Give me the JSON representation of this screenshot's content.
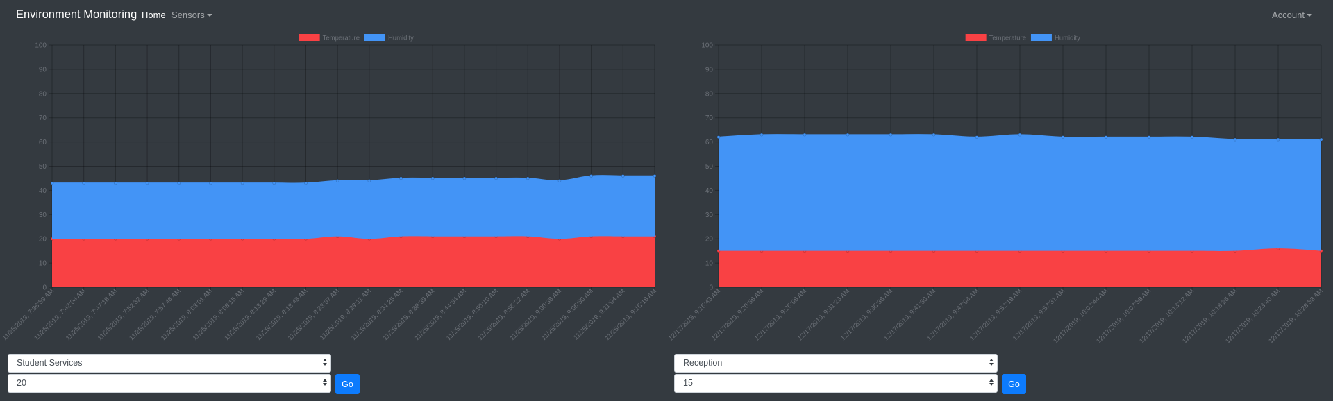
{
  "nav": {
    "brand": "Environment Monitoring",
    "home": "Home",
    "sensors": "Sensors",
    "account": "Account"
  },
  "colors": {
    "background": "#343a40",
    "temperature": "#f94144",
    "humidity": "#4394f6",
    "go_button": "#0d7bfd"
  },
  "chart_data": [
    {
      "type": "area",
      "stacked": true,
      "legend_position": "top",
      "grid": true,
      "ylim": [
        0,
        100
      ],
      "y_ticks": [
        0,
        10,
        20,
        30,
        40,
        50,
        60,
        70,
        80,
        90,
        100
      ],
      "x": [
        "11/25/2019, 7:36:59 AM",
        "11/25/2019, 7:42:04 AM",
        "11/25/2019, 7:47:18 AM",
        "11/25/2019, 7:52:32 AM",
        "11/25/2019, 7:57:46 AM",
        "11/25/2019, 8:03:01 AM",
        "11/25/2019, 8:08:15 AM",
        "11/25/2019, 8:13:29 AM",
        "11/25/2019, 8:18:43 AM",
        "11/25/2019, 8:23:57 AM",
        "11/25/2019, 8:29:11 AM",
        "11/25/2019, 8:34:25 AM",
        "11/25/2019, 8:39:39 AM",
        "11/25/2019, 8:44:54 AM",
        "11/25/2019, 8:50:10 AM",
        "11/25/2019, 8:55:22 AM",
        "11/25/2019, 9:00:36 AM",
        "11/25/2019, 9:05:50 AM",
        "11/25/2019, 9:11:04 AM",
        "11/25/2019, 9:16:18 AM"
      ],
      "series": [
        {
          "name": "Temperature",
          "values": [
            20,
            20,
            20,
            20,
            20,
            20,
            20,
            20,
            20,
            21,
            20,
            21,
            21,
            21,
            21,
            21,
            20,
            21,
            21,
            21
          ]
        },
        {
          "name": "Humidity",
          "values": [
            23,
            23,
            23,
            23,
            23,
            23,
            23,
            23,
            23,
            23,
            24,
            24,
            24,
            24,
            24,
            24,
            24,
            25,
            25,
            25
          ]
        }
      ]
    },
    {
      "type": "area",
      "stacked": true,
      "legend_position": "top",
      "grid": true,
      "ylim": [
        0,
        100
      ],
      "y_ticks": [
        0,
        10,
        20,
        30,
        40,
        50,
        60,
        70,
        80,
        90,
        100
      ],
      "x": [
        "12/17/2019, 9:15:43 AM",
        "12/17/2019, 9:20:58 AM",
        "12/17/2019, 9:26:08 AM",
        "12/17/2019, 9:31:23 AM",
        "12/17/2019, 9:36:36 AM",
        "12/17/2019, 9:41:50 AM",
        "12/17/2019, 9:47:04 AM",
        "12/17/2019, 9:52:18 AM",
        "12/17/2019, 9:57:31 AM",
        "12/17/2019, 10:02:44 AM",
        "12/17/2019, 10:07:58 AM",
        "12/17/2019, 10:13:12 AM",
        "12/17/2019, 10:18:26 AM",
        "12/17/2019, 10:23:40 AM",
        "12/17/2019, 10:28:53 AM"
      ],
      "series": [
        {
          "name": "Temperature",
          "values": [
            15,
            15,
            15,
            15,
            15,
            15,
            15,
            15,
            15,
            15,
            15,
            15,
            15,
            16,
            15
          ]
        },
        {
          "name": "Humidity",
          "values": [
            47,
            48,
            48,
            48,
            48,
            48,
            47,
            48,
            47,
            47,
            47,
            47,
            46,
            45,
            46
          ]
        }
      ]
    }
  ],
  "controls": [
    {
      "location": "Student Services",
      "count": "20",
      "go": "Go"
    },
    {
      "location": "Reception",
      "count": "15",
      "go": "Go"
    }
  ]
}
